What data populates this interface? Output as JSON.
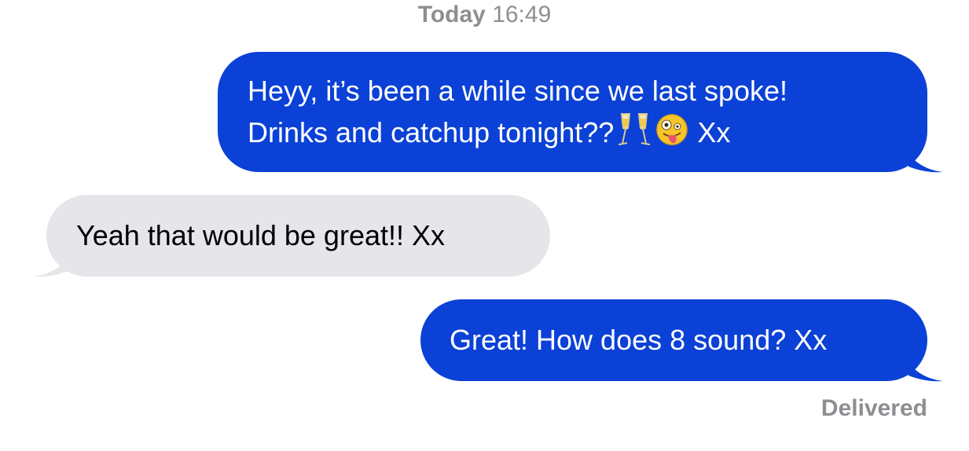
{
  "conversation": {
    "timestamp_day": "Today",
    "timestamp_time": "16:49",
    "status": "Delivered",
    "messages": [
      {
        "direction": "outgoing",
        "line1": "Heyy, it’s been a while since we last spoke!",
        "line2": "Drinks and catchup tonight??",
        "emojis": [
          "clinking-champagne-glasses-icon",
          "zany-face-icon"
        ],
        "suffix": "Xx"
      },
      {
        "direction": "incoming",
        "text": "Yeah that would be great!! Xx"
      },
      {
        "direction": "outgoing",
        "text": "Great! How does 8 sound? Xx"
      }
    ]
  },
  "colors": {
    "outgoing_bubble": "#0b41d6",
    "incoming_bubble": "#e5e5ea",
    "meta_text": "#8e8e93",
    "background": "#ffffff"
  }
}
